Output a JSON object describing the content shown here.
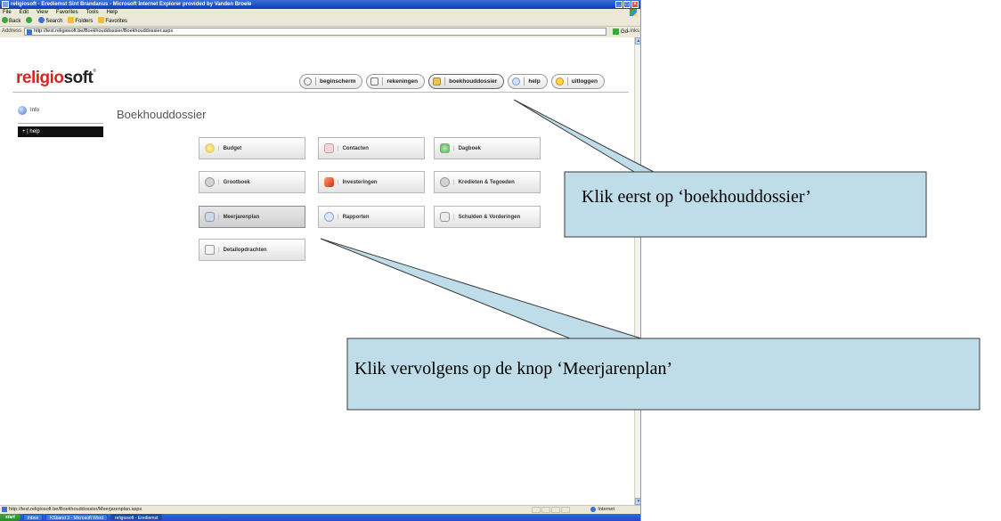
{
  "window": {
    "title": "religiosoft - Erediemst Sint Brandanus - Microsoft Internet Explorer provided by Vanden Broele",
    "controls": [
      "_",
      "□",
      "×"
    ]
  },
  "menu": [
    "File",
    "Edit",
    "View",
    "Favorites",
    "Tools",
    "Help"
  ],
  "toolbar": {
    "back": "Back",
    "search": "Search",
    "folders": "Folders",
    "favorites": "Favorites"
  },
  "address": {
    "label": "Address",
    "url": "http://test.religiosoft.be/Boekhouddossier/Boekhouddossier.aspx",
    "go": "Go",
    "links": "Links"
  },
  "app": {
    "logo_main": "religio",
    "logo_sub": "soft",
    "logo_reg": "®",
    "nav": [
      {
        "label": "beginscherm",
        "icon": "home-icon"
      },
      {
        "label": "rekeningen",
        "icon": "list-icon"
      },
      {
        "label": "boekhouddossier",
        "icon": "folder-icon"
      },
      {
        "label": "help",
        "icon": "help-icon"
      },
      {
        "label": "uitloggen",
        "icon": "logout-icon"
      }
    ],
    "sidebar": {
      "info": "Info",
      "help": "+ | help"
    },
    "page_title": "Boekhouddossier",
    "tiles": [
      {
        "label": "Budget",
        "icon": "budget-icon"
      },
      {
        "label": "Contacten",
        "icon": "contacts-icon"
      },
      {
        "label": "Dagboek",
        "icon": "dagboek-icon"
      },
      {
        "label": "Grootboek",
        "icon": "grootboek-icon"
      },
      {
        "label": "Investeringen",
        "icon": "investeringen-icon"
      },
      {
        "label": "Kredieten & Tegoeden",
        "icon": "kredieten-icon"
      },
      {
        "label": "Meerjarenplan",
        "icon": "meerjarenplan-icon"
      },
      {
        "label": "Rapporten",
        "icon": "rapporten-icon"
      },
      {
        "label": "Schulden & Vorderingen",
        "icon": "schulden-icon"
      },
      {
        "label": "Detailopdrachten",
        "icon": "detailopdrachten-icon"
      }
    ],
    "tile_separator": "|"
  },
  "statusbar": {
    "url": "http://test.religiosoft.be/Boekhouddossier/Meerjarenplan.aspx",
    "zone": "Internet"
  },
  "taskbar": {
    "start": "start",
    "tasks": [
      "Inbox",
      "KSband 3 - Microsoft Word",
      "religiosoft - Erediemst"
    ]
  },
  "callouts": [
    {
      "text": "Klik eerst op ‘boekhouddossier’"
    },
    {
      "text": "Klik vervolgens op de knop ‘Meerjarenplan’"
    }
  ]
}
